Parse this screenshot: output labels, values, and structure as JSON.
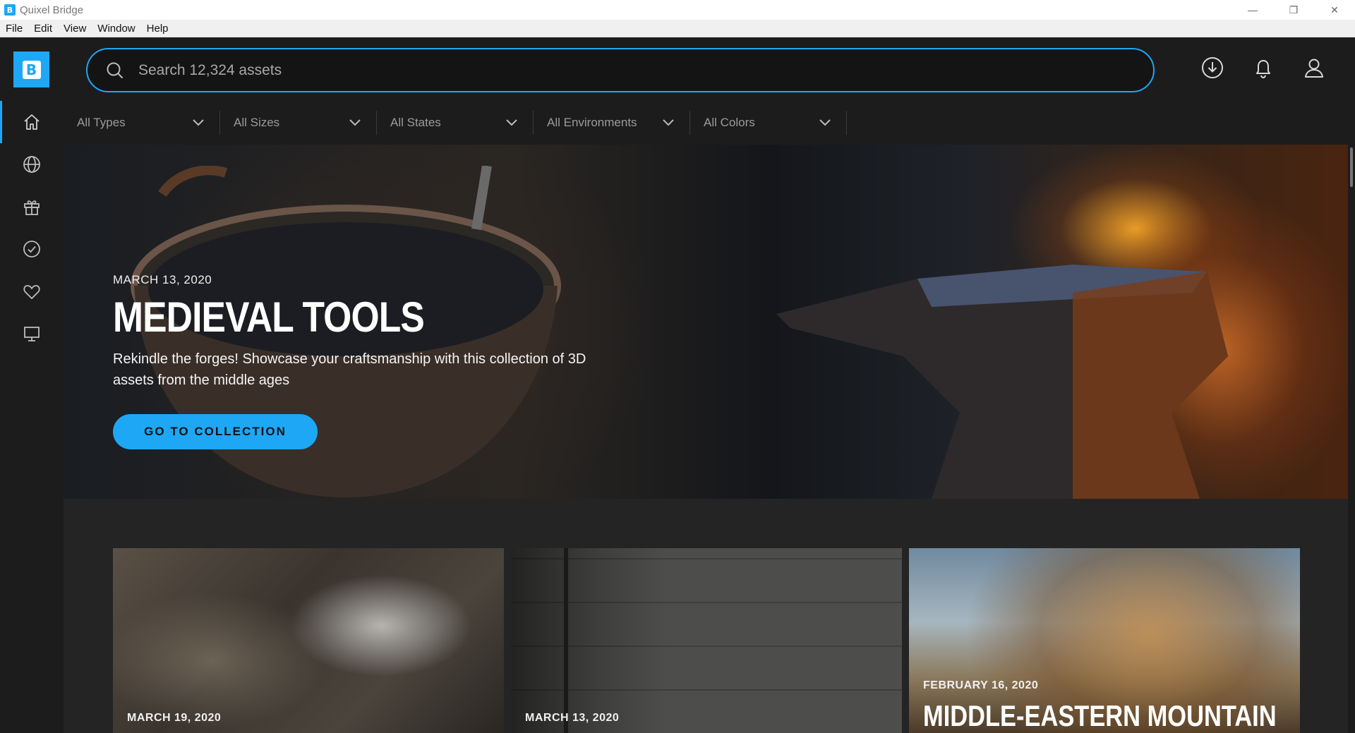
{
  "window": {
    "title": "Quixel Bridge",
    "app_icon": "B",
    "controls": {
      "minimize": "—",
      "maximize": "❐",
      "close": "✕"
    }
  },
  "menubar": {
    "items": [
      "File",
      "Edit",
      "View",
      "Window",
      "Help"
    ]
  },
  "header": {
    "logo_glyph": "B",
    "search": {
      "placeholder": "Search 12,324 assets",
      "value": ""
    },
    "icons": [
      "download-icon",
      "bell-icon",
      "user-icon"
    ]
  },
  "sidebar": {
    "items": [
      {
        "icon": "home-icon",
        "active": true
      },
      {
        "icon": "globe-icon",
        "active": false
      },
      {
        "icon": "gift-icon",
        "active": false
      },
      {
        "icon": "check-circle-icon",
        "active": false
      },
      {
        "icon": "heart-icon",
        "active": false
      },
      {
        "icon": "monitor-icon",
        "active": false
      }
    ]
  },
  "filters": [
    {
      "label": "All Types"
    },
    {
      "label": "All Sizes"
    },
    {
      "label": "All States"
    },
    {
      "label": "All Environments"
    },
    {
      "label": "All Colors"
    }
  ],
  "hero": {
    "date": "MARCH 13, 2020",
    "title": "MEDIEVAL TOOLS",
    "description": "Rekindle the forges! Showcase your craftsmanship with this collection of 3D assets from the middle ages",
    "button_label": "GO TO COLLECTION"
  },
  "cards": [
    {
      "date": "MARCH 19, 2020",
      "title": ""
    },
    {
      "date": "MARCH 13, 2020",
      "title": ""
    },
    {
      "date": "FEBRUARY 16, 2020",
      "title": "MIDDLE-EASTERN MOUNTAIN"
    }
  ],
  "colors": {
    "accent": "#1ea7f5",
    "background": "#1c1c1c",
    "content_background": "#242424"
  }
}
